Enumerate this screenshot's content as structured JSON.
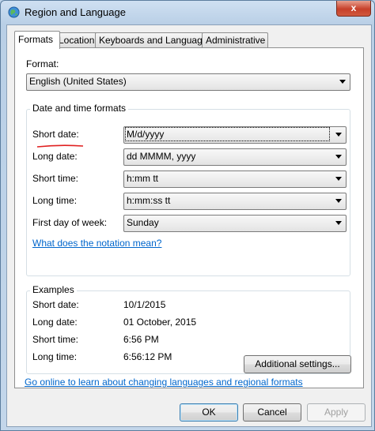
{
  "window": {
    "title": "Region and Language",
    "close_label": "x",
    "icon": "globe-icon"
  },
  "tabs": [
    {
      "label": "Formats",
      "active": true
    },
    {
      "label": "Location",
      "active": false
    },
    {
      "label": "Keyboards and Languages",
      "active": false
    },
    {
      "label": "Administrative",
      "active": false
    }
  ],
  "format": {
    "label": "Format:",
    "selected": "English (United States)"
  },
  "date_time_formats": {
    "group_title": "Date and time formats",
    "short_date": {
      "label": "Short date:",
      "value": "M/d/yyyy"
    },
    "long_date": {
      "label": "Long date:",
      "value": "dd MMMM, yyyy"
    },
    "short_time": {
      "label": "Short time:",
      "value": "h:mm tt"
    },
    "long_time": {
      "label": "Long time:",
      "value": "h:mm:ss tt"
    },
    "first_day": {
      "label": "First day of week:",
      "value": "Sunday"
    },
    "notation_link": "What does the notation mean?"
  },
  "examples": {
    "group_title": "Examples",
    "rows": [
      {
        "label": "Short date:",
        "value": "10/1/2015"
      },
      {
        "label": "Long date:",
        "value": "01 October, 2015"
      },
      {
        "label": "Short time:",
        "value": "6:56 PM"
      },
      {
        "label": "Long time:",
        "value": "6:56:12 PM"
      }
    ]
  },
  "additional_settings": "Additional settings...",
  "online_link": "Go online to learn about changing languages and regional formats",
  "buttons": {
    "ok": "OK",
    "cancel": "Cancel",
    "apply": "Apply"
  },
  "colors": {
    "link": "#0066cc",
    "annotation_underline": "#e02020"
  }
}
